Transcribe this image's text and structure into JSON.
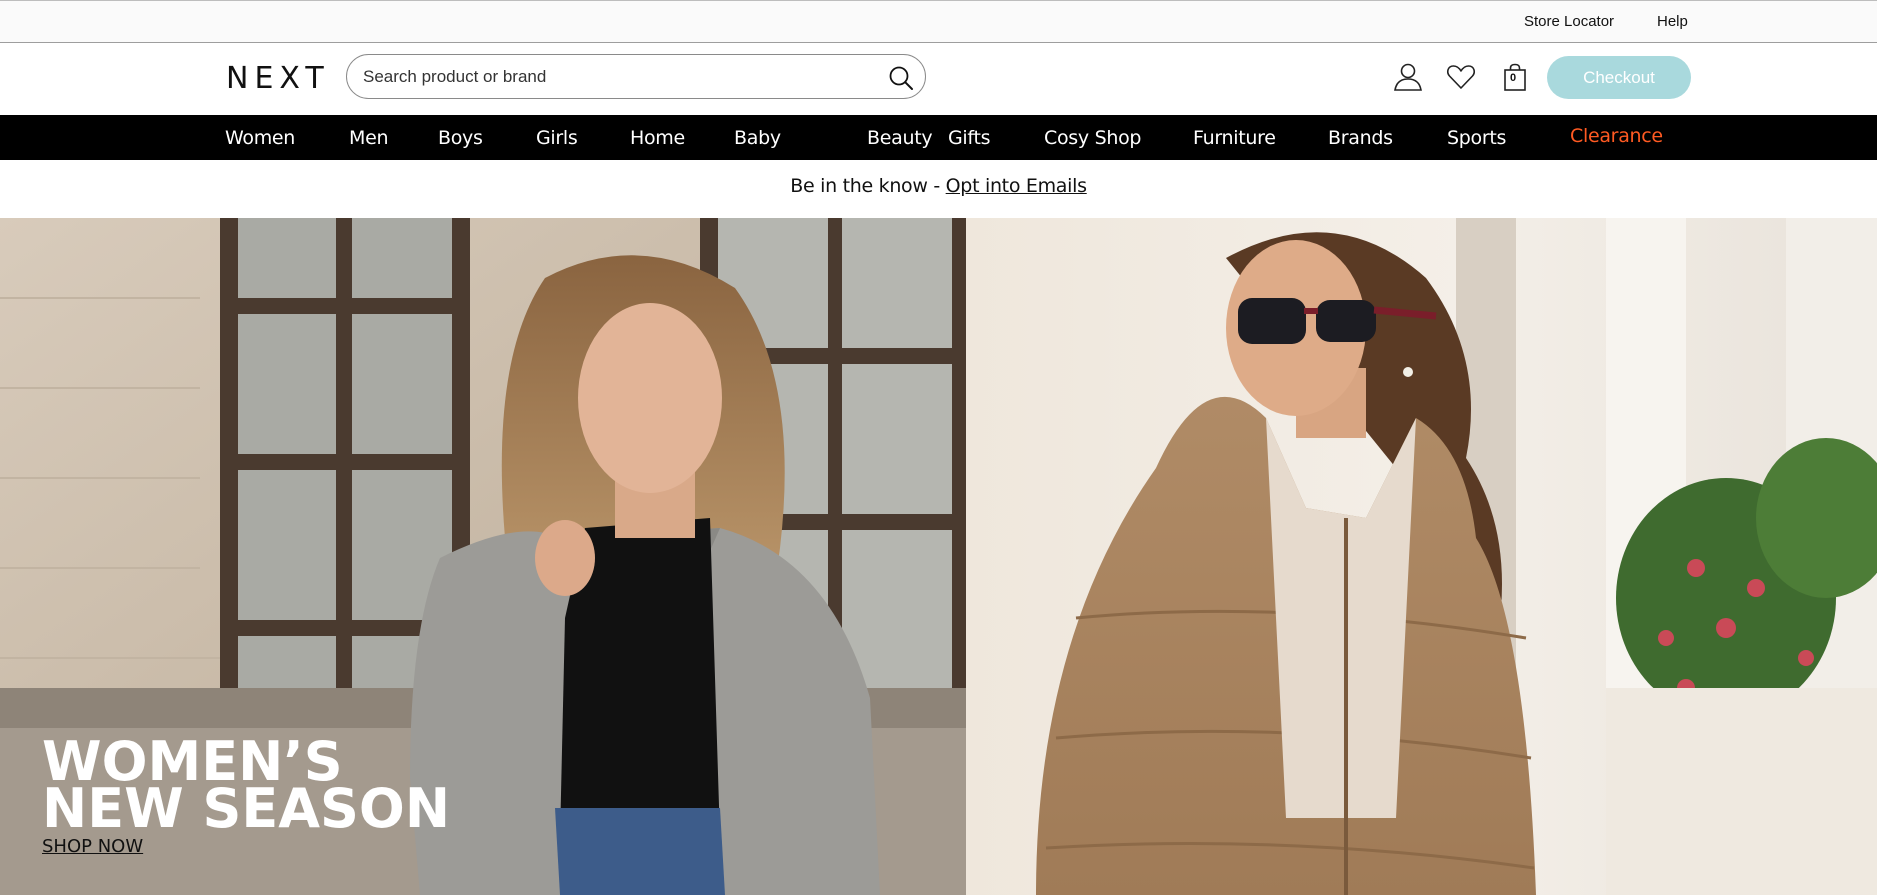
{
  "utility": {
    "store_locator": "Store Locator",
    "help": "Help"
  },
  "header": {
    "logo": "NEXT",
    "search_placeholder": "Search product or brand",
    "bag_count": "0",
    "checkout_label": "Checkout",
    "icons": [
      "search-icon",
      "account-icon",
      "heart-icon",
      "bag-icon"
    ]
  },
  "nav": {
    "items": [
      "Women",
      "Men",
      "Boys",
      "Girls",
      "Home",
      "Baby",
      "Beauty",
      "Gifts",
      "Cosy Shop",
      "Furniture",
      "Brands",
      "Sports"
    ],
    "clearance": "Clearance"
  },
  "promo": {
    "text": "Be in the know - ",
    "link": "Opt into Emails"
  },
  "hero": {
    "left": {
      "title_line1": "WOMEN’S",
      "title_line2": "NEW SEASON",
      "cta": "SHOP NOW"
    }
  },
  "colors": {
    "nav_bg": "#000000",
    "clearance": "#ff5a22",
    "checkout_bg": "#a9d9dd"
  }
}
